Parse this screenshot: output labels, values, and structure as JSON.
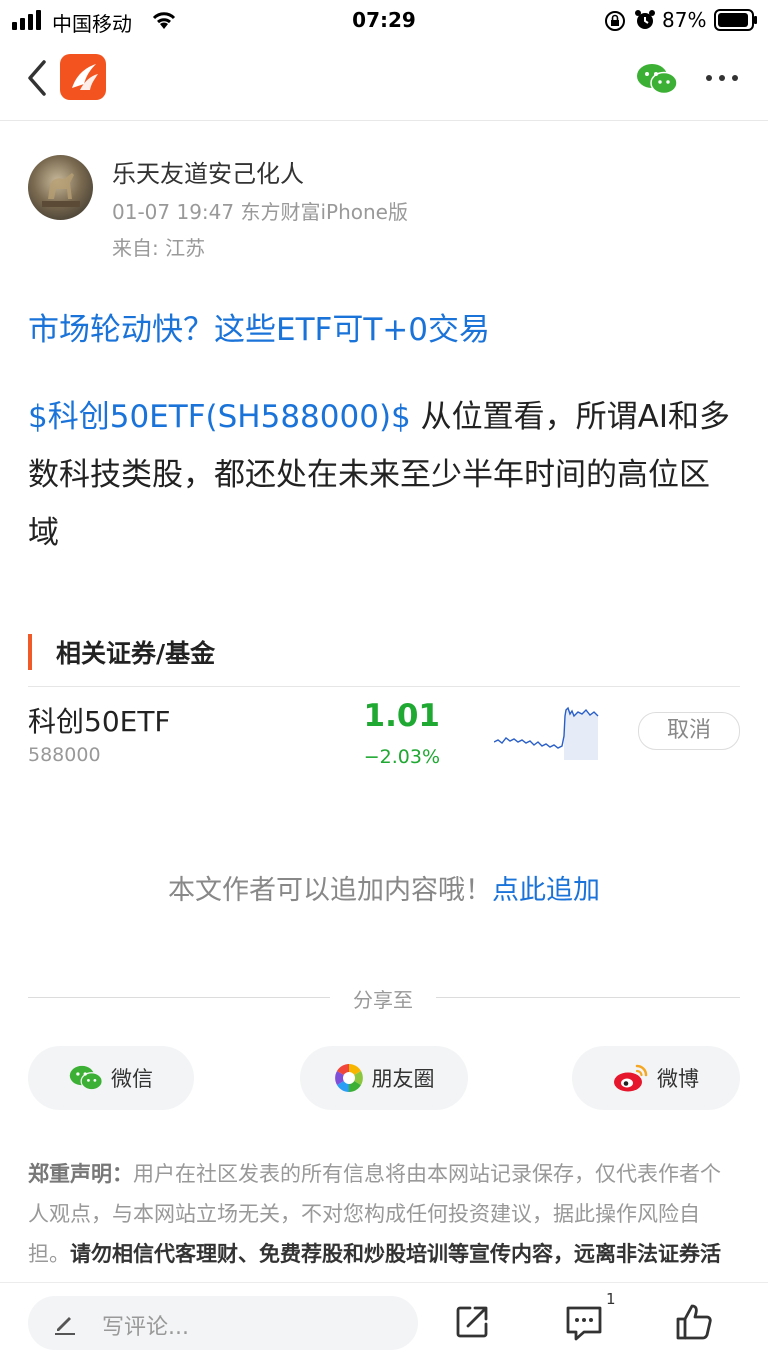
{
  "status_bar": {
    "carrier": "中国移动",
    "time": "07:29",
    "battery": "87%"
  },
  "nav": {
    "back_icon": "chevron-left-icon",
    "logo_icon": "eastmoney-logo-icon",
    "wechat_icon": "wechat-icon",
    "more_icon": "more-dots-icon"
  },
  "author": {
    "name": "乐天友道安己化人",
    "meta": "01-07 19:47 东方财富iPhone版",
    "from": "来自: 江苏"
  },
  "post": {
    "title": "市场轮动快？这些ETF可T+0交易",
    "stock_link": "$科创50ETF(SH588000)$",
    "body": "从位置看，所谓AI和多数科技类股，都还处在未来至少半年时间的高位区域"
  },
  "related": {
    "header": "相关证券/基金",
    "items": [
      {
        "name": "科创50ETF",
        "code": "588000",
        "price": "1.01",
        "change": "−2.03%",
        "action": "取消"
      }
    ]
  },
  "add_content": {
    "prompt": "本文作者可以追加内容哦！",
    "link": "点此追加"
  },
  "share": {
    "label": "分享至",
    "buttons": [
      {
        "label": "微信",
        "icon": "wechat-icon"
      },
      {
        "label": "朋友圈",
        "icon": "moments-icon"
      },
      {
        "label": "微博",
        "icon": "weibo-icon"
      }
    ]
  },
  "disclaimer": {
    "lead": "郑重声明：",
    "text": "用户在社区发表的所有信息将由本网站记录保存，仅代表作者个人观点，与本网站立场无关，不对您构成任何投资建议，据此操作风险自担。",
    "warning": "请勿相信代客理财、免费荐股和炒股培训等宣传内容，远离非法证券活动。请勿添加发言用户的手机号码、公众"
  },
  "bottom_bar": {
    "comment_placeholder": "写评论...",
    "comment_count": "1",
    "share_icon": "share-out-icon",
    "comment_icon": "comment-icon",
    "like_icon": "thumbs-up-icon"
  },
  "colors": {
    "link_blue": "#1a73d9",
    "down_green": "#1fa832",
    "accent_orange": "#f05a28"
  }
}
